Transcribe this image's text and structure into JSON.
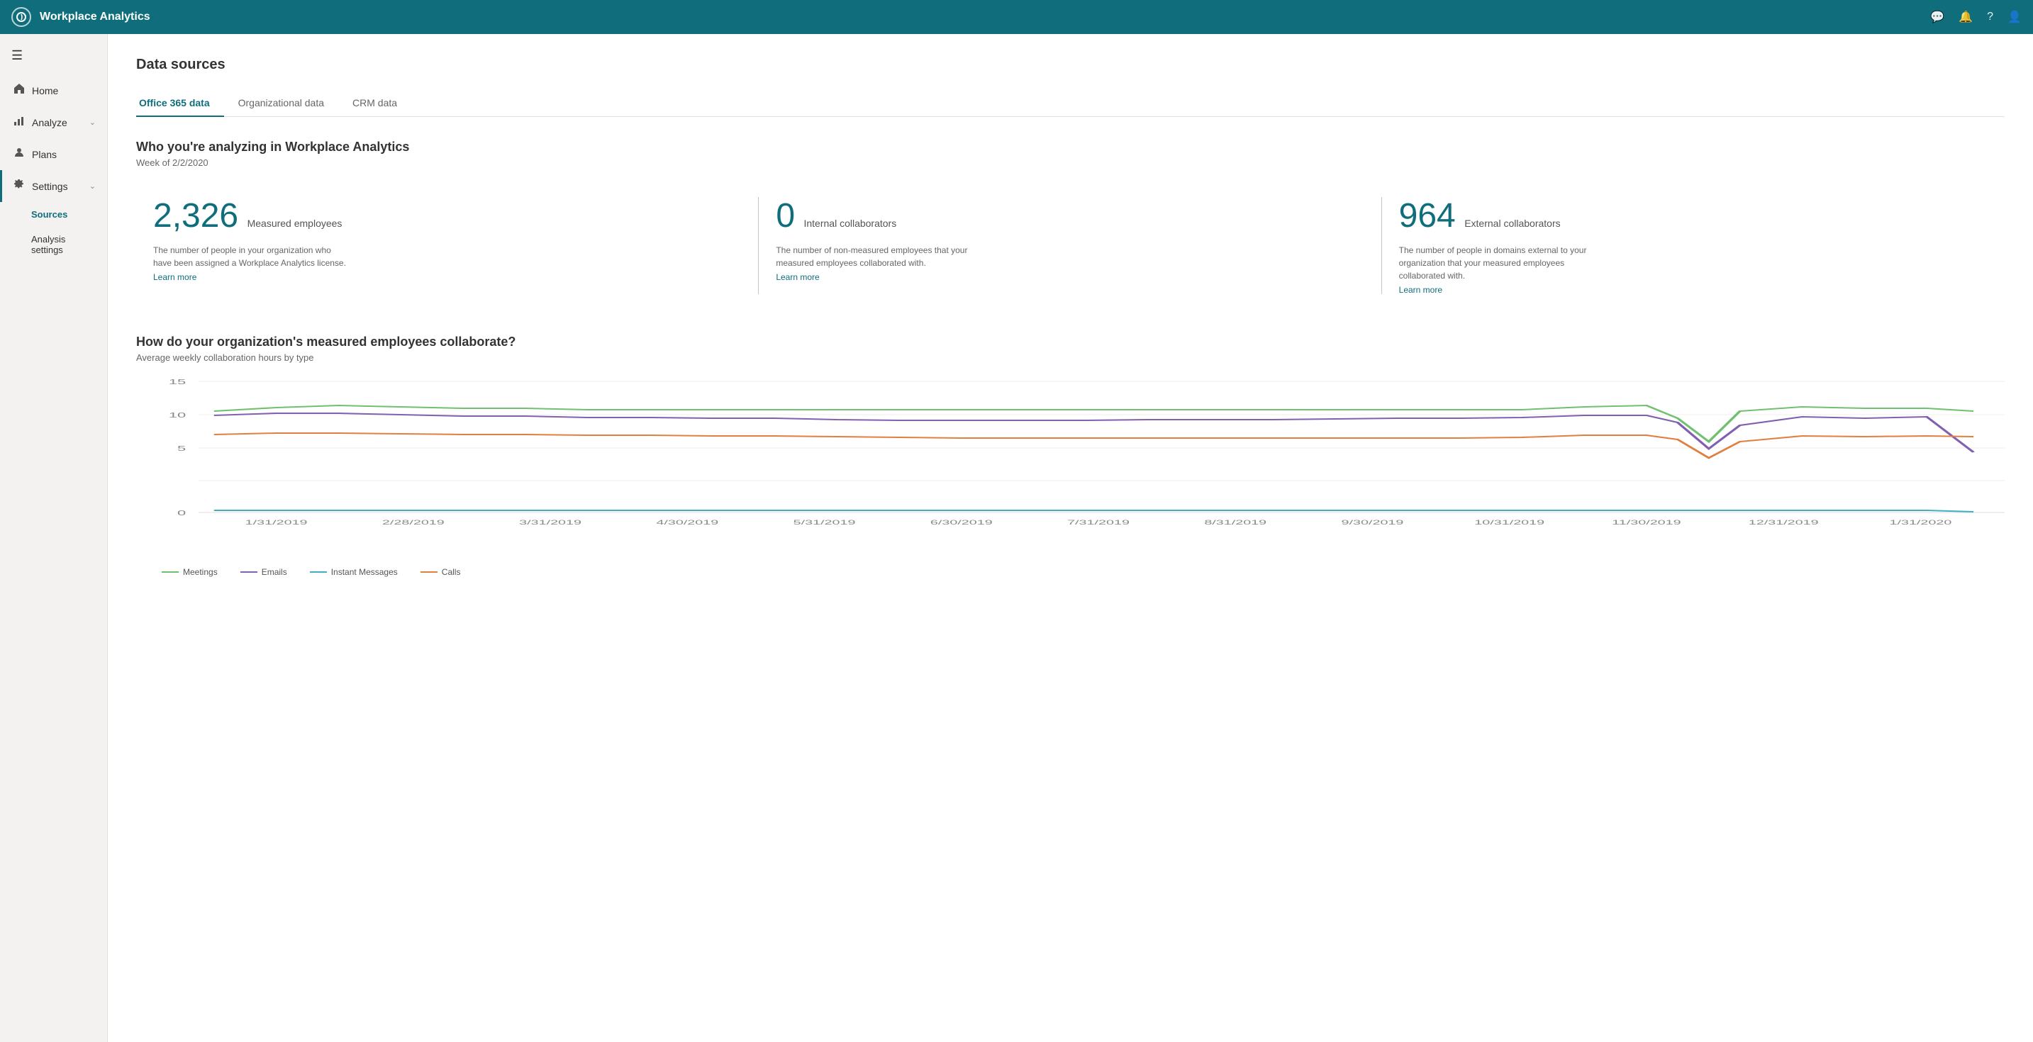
{
  "topbar": {
    "title": "Workplace Analytics",
    "logo_symbol": "○",
    "icons": [
      "feedback",
      "notification",
      "help",
      "account"
    ]
  },
  "sidebar": {
    "hamburger": "☰",
    "items": [
      {
        "id": "home",
        "label": "Home",
        "icon": "🏠",
        "has_chevron": false,
        "active": false
      },
      {
        "id": "analyze",
        "label": "Analyze",
        "icon": "📊",
        "has_chevron": true,
        "active": false
      },
      {
        "id": "plans",
        "label": "Plans",
        "icon": "👤",
        "has_chevron": false,
        "active": false
      },
      {
        "id": "settings",
        "label": "Settings",
        "icon": "⚙",
        "has_chevron": true,
        "active": true
      }
    ],
    "sub_items": [
      {
        "id": "sources",
        "label": "Sources",
        "active": true
      },
      {
        "id": "analysis-settings",
        "label": "Analysis settings",
        "active": false
      }
    ]
  },
  "page": {
    "title": "Data sources",
    "tabs": [
      {
        "id": "office365",
        "label": "Office 365 data",
        "active": true
      },
      {
        "id": "org",
        "label": "Organizational data",
        "active": false
      },
      {
        "id": "crm",
        "label": "CRM data",
        "active": false
      }
    ],
    "section1": {
      "title": "Who you're analyzing in Workplace Analytics",
      "subtitle": "Week of 2/2/2020",
      "stats": [
        {
          "id": "measured-employees",
          "number": "2,326",
          "label": "Measured employees",
          "desc": "The number of people in your organization who have been assigned a Workplace Analytics license.",
          "link": "Learn more"
        },
        {
          "id": "internal-collaborators",
          "number": "0",
          "label": "Internal collaborators",
          "desc": "The number of non-measured employees that your measured employees collaborated with.",
          "link": "Learn more"
        },
        {
          "id": "external-collaborators",
          "number": "964",
          "label": "External collaborators",
          "desc": "The number of people in domains external to your organization that your measured employees collaborated with.",
          "link": "Learn more"
        }
      ]
    },
    "section2": {
      "title": "How do your organization's measured employees collaborate?",
      "subtitle": "Average weekly collaboration hours by type",
      "chart": {
        "y_labels": [
          "0",
          "5",
          "10",
          "15"
        ],
        "x_labels": [
          "1/31/2019",
          "2/28/2019",
          "3/31/2019",
          "4/30/2019",
          "5/31/2019",
          "6/30/2019",
          "7/31/2019",
          "8/31/2019",
          "9/30/2019",
          "10/31/2019",
          "11/30/2019",
          "12/31/2019",
          "1/31/2020"
        ],
        "legend": [
          {
            "id": "meetings",
            "label": "Meetings",
            "color": "#70c070"
          },
          {
            "id": "emails",
            "label": "Emails",
            "color": "#8060b0"
          },
          {
            "id": "instant-messages",
            "label": "Instant Messages",
            "color": "#40b0c0"
          },
          {
            "id": "calls",
            "label": "Calls",
            "color": "#e08040"
          }
        ]
      }
    }
  }
}
